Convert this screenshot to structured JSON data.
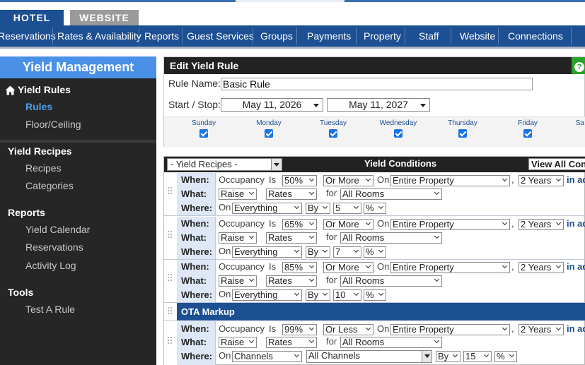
{
  "top_tabs": {
    "hotel": "HOTEL",
    "website": "WEBSITE"
  },
  "nav": [
    "Reservations",
    "Rates & Availability",
    "Reports",
    "Guest Services",
    "Groups",
    "Payments",
    "Property",
    "Staff",
    "Website",
    "Connections"
  ],
  "sidebar": {
    "title": "Yield Management",
    "sections": [
      {
        "heading": "Yield Rules",
        "links": [
          "Rules",
          "Floor/Ceiling"
        ],
        "active": "Rules"
      },
      {
        "heading": "Yield Recipes",
        "links": [
          "Recipes",
          "Categories"
        ]
      },
      {
        "heading": "Reports",
        "links": [
          "Yield Calendar",
          "Reservations",
          "Activity Log"
        ]
      },
      {
        "heading": "Tools",
        "links": [
          "Test A Rule"
        ]
      }
    ]
  },
  "edit_rule": {
    "title": "Edit Yield Rule",
    "rule_name_label": "Rule Name:",
    "rule_name_value": "Basic Rule",
    "start_stop_label": "Start / Stop:",
    "start_date": "May 11, 2026",
    "stop_date": "May 11, 2027",
    "help_icon": "question-icon",
    "days": [
      "Sunday",
      "Monday",
      "Tuesday",
      "Wednesday",
      "Thursday",
      "Friday",
      "Sa"
    ]
  },
  "conditions": {
    "recipes_select": "- Yield Recipes -",
    "title": "Yield Conditions",
    "view_all": "View All Con",
    "labels": {
      "when": "When:",
      "what": "What:",
      "where": "Where:",
      "occupancy": "Occupancy",
      "is": "Is",
      "on": "On",
      "for": "for",
      "by": "By",
      "comma": ",",
      "in_adv": "in ad"
    },
    "rows": [
      {
        "pct": "50%",
        "cmp": "Or More",
        "scope": "Entire Property",
        "period": "2 Years",
        "action": "Raise",
        "target": "Rates",
        "rooms": "All Rooms",
        "on_what": "Everything",
        "by": "By",
        "amount": "5",
        "unit": "%"
      },
      {
        "pct": "65%",
        "cmp": "Or More",
        "scope": "Entire Property",
        "period": "2 Years",
        "action": "Raise",
        "target": "Rates",
        "rooms": "All Rooms",
        "on_what": "Everything",
        "by": "By",
        "amount": "7",
        "unit": "%"
      },
      {
        "pct": "85%",
        "cmp": "Or More",
        "scope": "Entire Property",
        "period": "2 Years",
        "action": "Raise",
        "target": "Rates",
        "rooms": "All Rooms",
        "on_what": "Everything",
        "by": "By",
        "amount": "10",
        "unit": "%"
      }
    ],
    "ota_title": "OTA Markup",
    "ota_row": {
      "pct": "99%",
      "cmp": "Or Less",
      "scope": "Entire Property",
      "period": "2 Years",
      "action": "Raise",
      "target": "Rates",
      "rooms": "All Rooms",
      "on_what": "Channels",
      "channels": "All Channels",
      "by": "By",
      "amount": "15",
      "unit": "%"
    }
  },
  "colors": {
    "nav_blue": "#1d4f93",
    "sidebar_bg": "#262626",
    "title_blue": "#4a90e6",
    "help_green": "#28a428"
  }
}
